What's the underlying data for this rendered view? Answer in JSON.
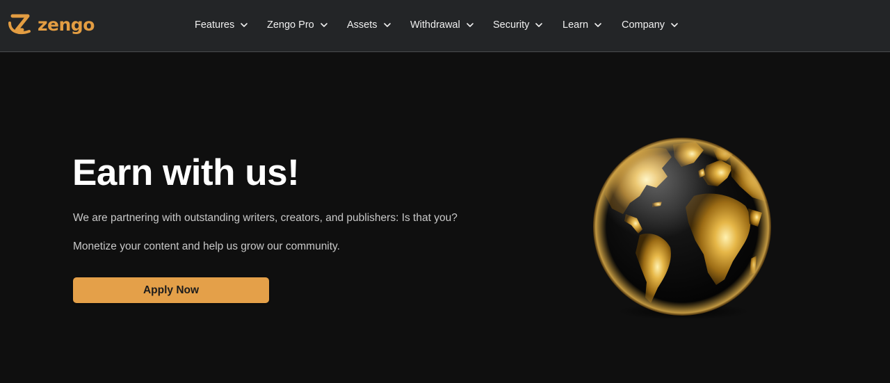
{
  "brand": {
    "name": "zengo",
    "accent_color": "#e39d42"
  },
  "nav": {
    "items": [
      {
        "label": "Features",
        "icon": "chevron-down-icon"
      },
      {
        "label": "Zengo Pro",
        "icon": "chevron-down-icon"
      },
      {
        "label": "Assets",
        "icon": "chevron-down-icon"
      },
      {
        "label": "Withdrawal",
        "icon": "chevron-down-icon"
      },
      {
        "label": "Security",
        "icon": "chevron-down-icon"
      },
      {
        "label": "Learn",
        "icon": "chevron-down-icon"
      },
      {
        "label": "Company",
        "icon": "chevron-down-icon"
      }
    ]
  },
  "hero": {
    "title": "Earn with us!",
    "paragraph_1": "We are partnering with outstanding writers, creators, and publishers: Is that you?",
    "paragraph_2": "Monetize your content and help us grow our community.",
    "cta_label": "Apply Now",
    "cta_color": "#e4a049",
    "image": "golden-globe"
  }
}
